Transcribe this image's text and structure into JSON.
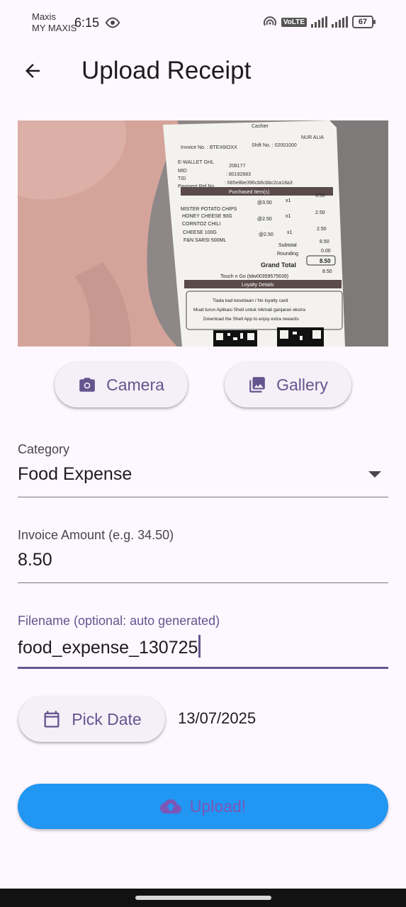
{
  "status_bar": {
    "carrier_line1": "Maxis",
    "carrier_line2": "MY MAXIS",
    "time": "6:15",
    "volte": "VoLTE",
    "battery": "67"
  },
  "app_bar": {
    "title": "Upload Receipt"
  },
  "receipt": {
    "invoice_no": "Invoice No. : BTEX6IOXX",
    "cashier": "Cashier",
    "cashier_name": "NUR ALIA",
    "shift_no": "Shift No. : 02001000",
    "ewallet": "E-WALLET GHL",
    "mid_label": "MID",
    "mid_value": "208177",
    "tid_label": "TID",
    "tid_value": ": 80192683",
    "payref_label": "Payment Ref No.",
    "payref_value": ": 685e8be396cb6cbbc2ca18a3",
    "purchased_header": "Purchased Item(s)",
    "items": [
      {
        "name": "MISTER POTATO CHIPS",
        "unit": "@3.50",
        "qty": "x1",
        "amount": "3.50"
      },
      {
        "name": "HONEY CHEESE 90G",
        "unit": "",
        "qty": "",
        "amount": ""
      },
      {
        "name": "CORNTOZ CHILI",
        "unit": "@2.50",
        "qty": "x1",
        "amount": "2.50"
      },
      {
        "name": "CHEESE 100G",
        "unit": "",
        "qty": "",
        "amount": ""
      },
      {
        "name": "F&N SARSI 500ML",
        "unit": "@2.50",
        "qty": "x1",
        "amount": "2.50"
      }
    ],
    "subtotal_label": "Subtotal",
    "subtotal_value": "8.50",
    "rounding_label": "Rounding",
    "rounding_value": "0.00",
    "grand_total_label": "Grand Total",
    "grand_total_value": "8.50",
    "touchngo": "Touch n Go (tdw00359575639)",
    "touchngo_value": "8.50",
    "loyalty_header": "Loyalty Details",
    "loyalty_line1": "Tiada kad kesetiaan / No loyalty card",
    "loyalty_line2": "Muat turun Aplikasi Shell untuk nikmati ganjaran ekstra",
    "loyalty_line3": "Download the Shell App to enjoy extra rewards"
  },
  "buttons": {
    "camera": "Camera",
    "gallery": "Gallery",
    "pick_date": "Pick Date",
    "upload": "Upload!"
  },
  "form": {
    "category_label": "Category",
    "category_value": "Food Expense",
    "amount_label": "Invoice Amount (e.g. 34.50)",
    "amount_value": "8.50",
    "filename_label": "Filename (optional: auto generated)",
    "filename_value": "food_expense_130725",
    "date_value": "13/07/2025"
  },
  "colors": {
    "background": "#fdf7ff",
    "accent": "#65558f",
    "upload_button": "#2196f3",
    "upload_text": "#7d55b5"
  }
}
